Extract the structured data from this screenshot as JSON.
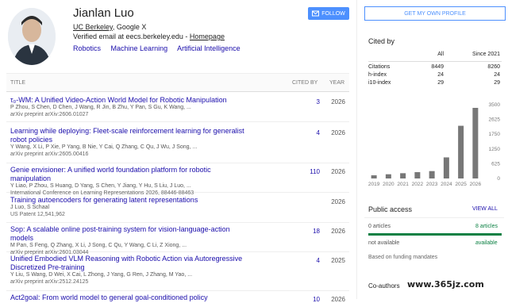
{
  "profile": {
    "name": "Jianlan Luo",
    "affiliation_link": "UC Berkeley",
    "affiliation_rest": ", Google X",
    "email": "Verified email at eecs.berkeley.edu - ",
    "homepage": "Homepage",
    "interests": [
      "Robotics",
      "Machine Learning",
      "Artificial Intelligence"
    ],
    "follow_label": "FOLLOW"
  },
  "table": {
    "headers": {
      "title": "TITLE",
      "cited": "CITED BY",
      "year": "YEAR"
    },
    "rows": [
      {
        "title": "τ₀-WM: A Unified Video-Action World Model for Robotic Manipulation",
        "authors": "P Zhou, S Chen, D Chen, J Wang, R Jin, B Zhu, Y Pan, S Gu, K Wang, ...",
        "venue": "arXiv preprint arXiv:2606.01027",
        "cited": "3",
        "year": "2026"
      },
      {
        "title": "Learning while deploying: Fleet-scale reinforcement learning for generalist robot policies",
        "authors": "Y Wang, X Li, P Xie, P Yang, B Nie, Y Cai, Q Zhang, C Qu, J Wu, J Song, ...",
        "venue": "arXiv preprint arXiv:2605.00416",
        "cited": "4",
        "year": "2026"
      },
      {
        "title": "Genie envisioner: A unified world foundation platform for robotic manipulation",
        "authors": "Y Liao, P Zhou, S Huang, D Yang, S Chen, Y Jiang, Y Hu, S Liu, J Luo, ...",
        "venue": "International Conference on Learning Representations 2026, 88446-88463",
        "cited": "110",
        "year": "2026"
      },
      {
        "title": "Training autoencoders for generating latent representations",
        "authors": "J Luo, S Schaal",
        "venue": "US Patent 12,541,962",
        "cited": "",
        "year": "2026"
      },
      {
        "title": "Sop: A scalable online post-training system for vision-language-action models",
        "authors": "M Pan, S Feng, Q Zhang, X Li, J Song, C Qu, Y Wang, C Li, Z Xiong, ...",
        "venue": "arXiv preprint arXiv:2601.03044",
        "cited": "18",
        "year": "2026"
      },
      {
        "title": "Unified Embodied VLM Reasoning with Robotic Action via Autoregressive Discretized Pre-training",
        "authors": "Y Liu, S Wang, D Wei, X Cai, L Zhong, J Yang, G Ren, J Zhang, M Yao, ...",
        "venue": "arXiv preprint arXiv:2512.24125",
        "cited": "4",
        "year": "2025"
      },
      {
        "title": "Act2goal: From world model to general goal-conditioned policy",
        "authors": "",
        "venue": "",
        "cited": "10",
        "year": "2026"
      }
    ]
  },
  "sidebar": {
    "my_profile_label": "GET MY OWN PROFILE",
    "cited_by_heading": "Cited by",
    "stats_headers": {
      "all": "All",
      "since": "Since 2021"
    },
    "stats": [
      {
        "label": "Citations",
        "all": "8449",
        "since": "8260"
      },
      {
        "label": "h-index",
        "all": "24",
        "since": "24"
      },
      {
        "label": "i10-index",
        "all": "29",
        "since": "29"
      }
    ],
    "public_access_heading": "Public access",
    "view_all_label": "VIEW ALL",
    "articles_unavailable": "0 articles",
    "articles_available": "8 articles",
    "not_available_label": "not available",
    "available_label": "available",
    "funding_note": "Based on funding mandates",
    "coauthors_heading": "Co-authors",
    "watermark": "www.365jz.com",
    "accent_color": "#4d90fe",
    "available_color": "#0b8043"
  },
  "chart_data": {
    "type": "bar",
    "categories": [
      "2019",
      "2020",
      "2021",
      "2022",
      "2023",
      "2024",
      "2025",
      "2026"
    ],
    "values": [
      150,
      200,
      250,
      300,
      350,
      1000,
      2500,
      3350
    ],
    "yticks": [
      "0",
      "625",
      "1250",
      "1750",
      "2625",
      "3500"
    ],
    "ylim": [
      0,
      3500
    ],
    "bar_color": "#777777"
  }
}
